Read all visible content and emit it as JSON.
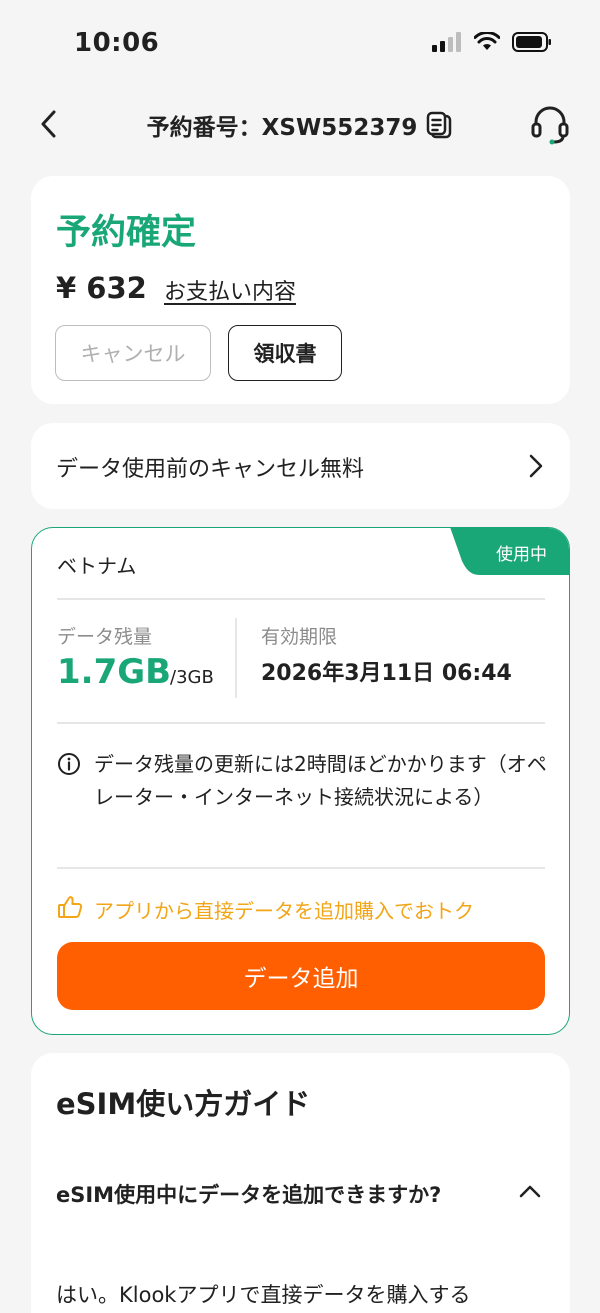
{
  "status_bar": {
    "time": "10:06"
  },
  "nav": {
    "title": "予約番号：XSW552379"
  },
  "status_card": {
    "title": "予約確定",
    "price": "¥ 632",
    "payment_link": "お支払い内容",
    "cancel_label": "キャンセル",
    "receipt_label": "領収書"
  },
  "policy": {
    "text": "データ使用前のキャンセル無料"
  },
  "esim": {
    "badge": "使用中",
    "country": "ベトナム",
    "remaining_label": "データ残量",
    "remaining_value": "1.7GB",
    "remaining_total": "/3GB",
    "expiry_label": "有効期限",
    "expiry_value": "2026年3月11日 06:44",
    "info_text": "データ残量の更新には2時間ほどかかります（オペレーター・インターネット接続状況による）",
    "promo_text": "アプリから直接データを追加購入でおトク",
    "add_data_label": "データ追加"
  },
  "guide": {
    "title": "eSIM使い方ガイド",
    "faq_question": "eSIM使用中にデータを追加できますか?",
    "faq_answer": "はい。Klookアプリで直接データを購入する"
  },
  "colors": {
    "accent_green": "#1aa777",
    "accent_orange": "#ff5f00",
    "promo_yellow": "#f2a516",
    "background": "#f5f5f5"
  }
}
